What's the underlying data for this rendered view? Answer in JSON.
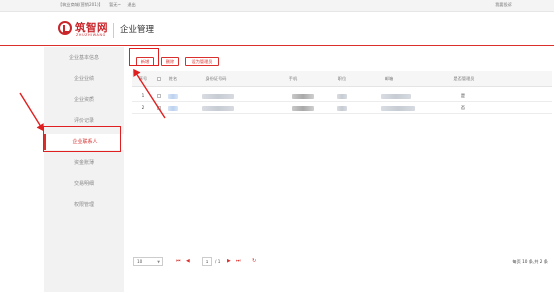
{
  "topbar": {
    "left_items": [
      "【筑业商城(营销201)】",
      "暂无~",
      "退出"
    ],
    "right_link": "我要投诉"
  },
  "header": {
    "logo_cn": "筑智网",
    "logo_en": "ZHUZHIWANG",
    "title": "企业管理"
  },
  "sidebar": {
    "items": [
      {
        "label": "企业基本信息",
        "active": false
      },
      {
        "label": "企业业绩",
        "active": false
      },
      {
        "label": "企业资质",
        "active": false
      },
      {
        "label": "评价记录",
        "active": false
      },
      {
        "label": "企业联系人",
        "active": true
      },
      {
        "label": "资金账薄",
        "active": false
      },
      {
        "label": "交易明细",
        "active": false
      },
      {
        "label": "权限管理",
        "active": false
      }
    ]
  },
  "toolbar": {
    "add_label": "新增",
    "delete_label": "删除",
    "set_admin_label": "设为管理员"
  },
  "table": {
    "headers": [
      "序号",
      "",
      "姓名",
      "身份证号码",
      "手机",
      "职位",
      "邮箱",
      "是否管理员"
    ],
    "rows": [
      {
        "index": "1",
        "is_admin": "是"
      },
      {
        "index": "2",
        "is_admin": "否"
      }
    ]
  },
  "pager": {
    "page_size": "10",
    "current_page": "1",
    "total_pages_text": "/ 1",
    "summary": "每页 10 条,共 2 条"
  },
  "colors": {
    "accent": "#d9302e",
    "sidebar_bg": "#f2f2f2",
    "annotation": "#e02020"
  },
  "icons": {
    "first": "first-page-icon",
    "prev": "prev-page-icon",
    "next": "next-page-icon",
    "last": "last-page-icon",
    "refresh": "refresh-icon"
  }
}
